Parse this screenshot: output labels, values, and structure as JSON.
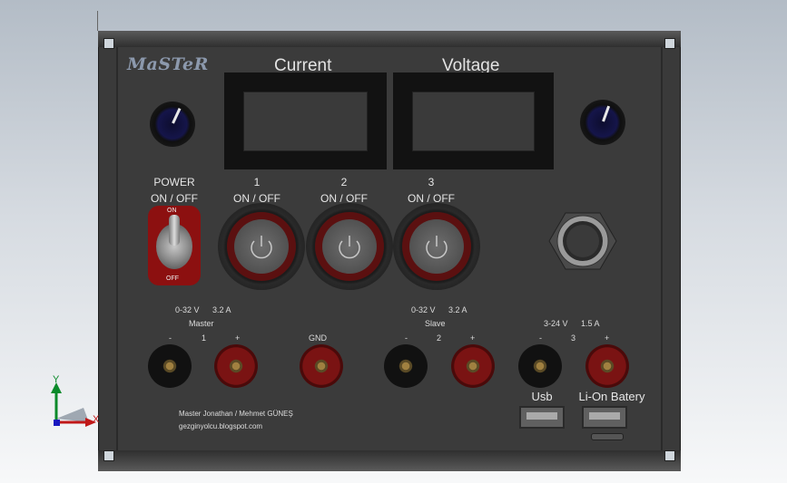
{
  "brand": "MaSTeR",
  "meters": {
    "current_title": "Current",
    "voltage_title": "Voltage"
  },
  "power": {
    "title": "POWER",
    "subtitle": "ON / OFF",
    "on": "ON",
    "off": "OFF"
  },
  "outputs": [
    {
      "num": "1",
      "label": "ON / OFF"
    },
    {
      "num": "2",
      "label": "ON / OFF"
    },
    {
      "num": "3",
      "label": "ON / OFF"
    }
  ],
  "master": {
    "spec_v": "0-32 V",
    "spec_a": "3.2 A",
    "name": "Master",
    "minus": "-",
    "num": "1",
    "plus": "+"
  },
  "gnd": "GND",
  "slave": {
    "spec_v": "0-32 V",
    "spec_a": "3.2 A",
    "name": "Slave",
    "minus": "-",
    "num": "2",
    "plus": "+"
  },
  "aux": {
    "spec_v": "3-24 V",
    "spec_a": "1.5 A",
    "minus": "-",
    "num": "3",
    "plus": "+"
  },
  "usb_label": "Usb",
  "battery_label": "Li-On Batery",
  "credits": {
    "authors": "Master Jonathan / Mehmet GÜNEŞ",
    "site": "gezginyolcu.blogspot.com"
  },
  "axes": {
    "x": "X",
    "y": "Y"
  },
  "colors": {
    "panel": "#3b3b3b",
    "logo": "#8c99ad",
    "jack_red": "#7a1313",
    "knob": "#15154a"
  }
}
